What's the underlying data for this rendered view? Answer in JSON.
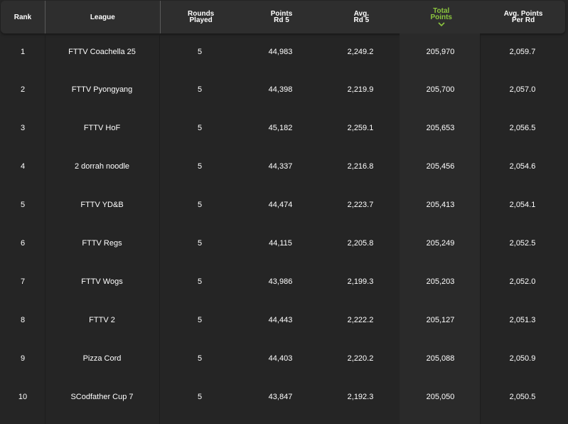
{
  "table": {
    "columns": [
      {
        "id": "rank",
        "lines": [
          "Rank"
        ]
      },
      {
        "id": "league",
        "lines": [
          "League"
        ]
      },
      {
        "id": "rounds_played",
        "lines": [
          "Rounds",
          "Played"
        ]
      },
      {
        "id": "points_rd5",
        "lines": [
          "Points",
          "Rd 5"
        ]
      },
      {
        "id": "avg_rd5",
        "lines": [
          "Avg.",
          "Rd 5"
        ]
      },
      {
        "id": "total_points",
        "lines": [
          "Total",
          "Points"
        ],
        "sorted": true
      },
      {
        "id": "avg_points_per_rd",
        "lines": [
          "Avg. Points",
          "Per Rd"
        ]
      }
    ],
    "rows": [
      {
        "rank": "1",
        "league": "FTTV Coachella 25",
        "rounds_played": "5",
        "points_rd5": "44,983",
        "avg_rd5": "2,249.2",
        "total_points": "205,970",
        "avg_points_per_rd": "2,059.7"
      },
      {
        "rank": "2",
        "league": "FTTV Pyongyang",
        "rounds_played": "5",
        "points_rd5": "44,398",
        "avg_rd5": "2,219.9",
        "total_points": "205,700",
        "avg_points_per_rd": "2,057.0"
      },
      {
        "rank": "3",
        "league": "FTTV HoF",
        "rounds_played": "5",
        "points_rd5": "45,182",
        "avg_rd5": "2,259.1",
        "total_points": "205,653",
        "avg_points_per_rd": "2,056.5"
      },
      {
        "rank": "4",
        "league": "2 dorrah noodle",
        "rounds_played": "5",
        "points_rd5": "44,337",
        "avg_rd5": "2,216.8",
        "total_points": "205,456",
        "avg_points_per_rd": "2,054.6"
      },
      {
        "rank": "5",
        "league": "FTTV YD&B",
        "rounds_played": "5",
        "points_rd5": "44,474",
        "avg_rd5": "2,223.7",
        "total_points": "205,413",
        "avg_points_per_rd": "2,054.1"
      },
      {
        "rank": "6",
        "league": "FTTV Regs",
        "rounds_played": "5",
        "points_rd5": "44,115",
        "avg_rd5": "2,205.8",
        "total_points": "205,249",
        "avg_points_per_rd": "2,052.5"
      },
      {
        "rank": "7",
        "league": "FTTV Wogs",
        "rounds_played": "5",
        "points_rd5": "43,986",
        "avg_rd5": "2,199.3",
        "total_points": "205,203",
        "avg_points_per_rd": "2,052.0"
      },
      {
        "rank": "8",
        "league": "FTTV 2",
        "rounds_played": "5",
        "points_rd5": "44,443",
        "avg_rd5": "2,222.2",
        "total_points": "205,127",
        "avg_points_per_rd": "2,051.3"
      },
      {
        "rank": "9",
        "league": "Pizza Cord",
        "rounds_played": "5",
        "points_rd5": "44,403",
        "avg_rd5": "2,220.2",
        "total_points": "205,088",
        "avg_points_per_rd": "2,050.9"
      },
      {
        "rank": "10",
        "league": "SCodfather Cup 7",
        "rounds_played": "5",
        "points_rd5": "43,847",
        "avg_rd5": "2,192.3",
        "total_points": "205,050",
        "avg_points_per_rd": "2,050.5"
      }
    ]
  },
  "colors": {
    "background": "#252525",
    "header_background": "#2e2e2e",
    "sorted_column_background": "#2a2a2a",
    "accent": "#8cc63f",
    "text": "#ffffff"
  },
  "icons": {
    "sort": "chevron-down-icon"
  }
}
